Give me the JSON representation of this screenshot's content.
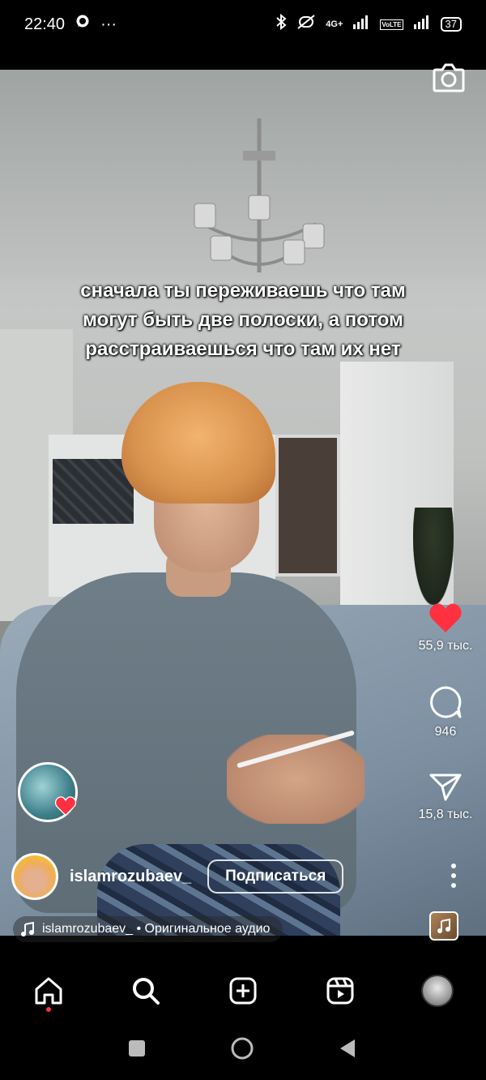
{
  "status_bar": {
    "time": "22:40",
    "overflow": "···",
    "network": "4G+",
    "lte": "VoLTE",
    "battery": "37",
    "icons": [
      "whatsapp-icon",
      "bluetooth-icon",
      "mute-icon",
      "signal-icon",
      "signal-icon",
      "battery-icon"
    ]
  },
  "video": {
    "caption_lines": [
      "сначала ты переживаешь что там",
      "могут быть две полоски, а потом",
      "расстраиваешься что там их нет"
    ]
  },
  "actions": {
    "likes": "55,9 тыс.",
    "comments": "946",
    "shares": "15,8 тыс.",
    "like_color": "#ff3040"
  },
  "author": {
    "username": "islamrozubaev_",
    "follow_label": "Подписаться"
  },
  "audio": {
    "text": "islamrozubaev_ • Оригинальное аудио"
  },
  "nav": {
    "items": [
      "home-icon",
      "search-icon",
      "create-icon",
      "reels-icon",
      "profile-avatar"
    ],
    "active": "home",
    "notification_color": "#ff3040"
  },
  "system_nav": [
    "recents-button",
    "home-button",
    "back-button"
  ]
}
